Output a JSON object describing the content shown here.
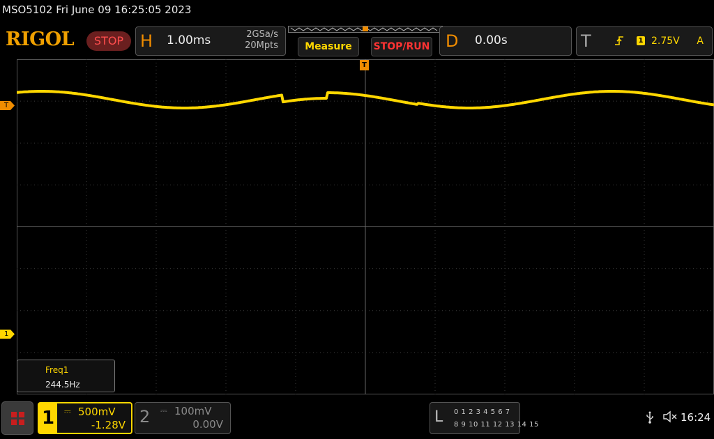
{
  "status_line": "MSO5102  Fri June 09 16:25:05 2023",
  "brand": "RIGOL",
  "run_state": "STOP",
  "horizontal": {
    "letter": "H",
    "timebase": "1.00ms",
    "sample_rate": "2GSa/s",
    "memory_depth": "20Mpts"
  },
  "buttons": {
    "measure": "Measure",
    "stop_run": "STOP/RUN"
  },
  "delay": {
    "letter": "D",
    "value": "0.00s"
  },
  "trigger": {
    "letter": "T",
    "source": "1",
    "level": "2.75V",
    "mode": "A"
  },
  "markers": {
    "trigger_position": "T",
    "trigger_level": "T",
    "ch1_offset": "1"
  },
  "measurement": {
    "name": "Freq1",
    "value": "244.5Hz"
  },
  "channels": [
    {
      "number": "1",
      "scale": "500mV",
      "offset": "-1.28V",
      "color": "#ffd700",
      "active": true
    },
    {
      "number": "2",
      "scale": "100mV",
      "offset": "0.00V",
      "color": "#8a8a8a",
      "active": false
    }
  ],
  "logic_analyzer": {
    "letter": "L",
    "row1": "0 1 2 3   4 5 6 7",
    "row2": "8  9 10 11 12 13 14 15"
  },
  "clock": "16:24",
  "colors": {
    "ch1": "#ffd700",
    "accent": "#f08c00",
    "stop": "#ff3333",
    "grid": "#3c3c3c"
  },
  "icons": {
    "home": "grid-menu-icon",
    "usb": "usb-icon",
    "speaker": "speaker-muted-icon",
    "edge": "rising-edge-icon"
  }
}
